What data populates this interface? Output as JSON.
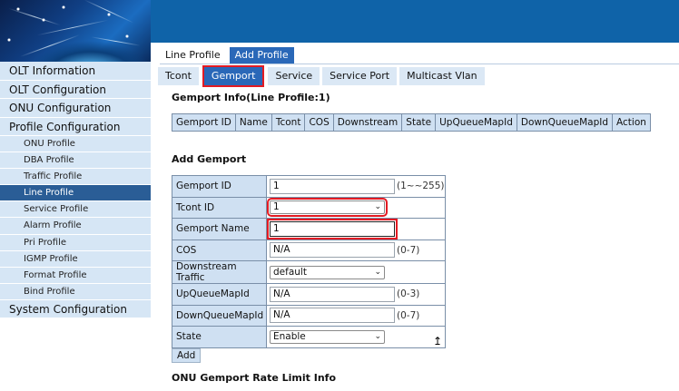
{
  "sidebar": {
    "items": [
      {
        "label": "OLT Information"
      },
      {
        "label": "OLT Configuration"
      },
      {
        "label": "ONU Configuration"
      },
      {
        "label": "Profile Configuration"
      }
    ],
    "profile_sub_items": [
      {
        "label": "ONU Profile"
      },
      {
        "label": "DBA Profile"
      },
      {
        "label": "Traffic Profile"
      },
      {
        "label": "Line Profile",
        "active": true
      },
      {
        "label": "Service Profile"
      },
      {
        "label": "Alarm Profile"
      },
      {
        "label": "Pri Profile"
      },
      {
        "label": "IGMP Profile"
      },
      {
        "label": "Format Profile"
      },
      {
        "label": "Bind Profile"
      }
    ],
    "last_item": {
      "label": "System Configuration"
    }
  },
  "top_tabs": [
    {
      "label": "Line Profile"
    },
    {
      "label": "Add Profile",
      "active": true
    }
  ],
  "sub_tabs": [
    {
      "label": "Tcont"
    },
    {
      "label": "Gemport",
      "active": true
    },
    {
      "label": "Service"
    },
    {
      "label": "Service Port"
    },
    {
      "label": "Multicast Vlan"
    }
  ],
  "gemport_info": {
    "title": "Gemport Info(Line Profile:1)",
    "columns": [
      "Gemport ID",
      "Name",
      "Tcont",
      "COS",
      "Downstream",
      "State",
      "UpQueueMapId",
      "DownQueueMapId",
      "Action"
    ]
  },
  "add_gemport": {
    "title": "Add Gemport",
    "fields": {
      "gemport_id": {
        "label": "Gemport ID",
        "value": "1",
        "hint": "(1~~255)"
      },
      "tcont_id": {
        "label": "Tcont ID",
        "value": "1"
      },
      "gemport_name": {
        "label": "Gemport Name",
        "value": "1"
      },
      "cos": {
        "label": "COS",
        "value": "N/A",
        "hint": "(0-7)"
      },
      "downstream_traffic": {
        "label": "Downstream Traffic",
        "value": "default"
      },
      "up_queue_map_id": {
        "label": "UpQueueMapId",
        "value": "N/A",
        "hint": "(0-3)"
      },
      "down_queue_map_id": {
        "label": "DownQueueMapId",
        "value": "N/A",
        "hint": "(0-7)"
      },
      "state": {
        "label": "State",
        "value": "Enable"
      }
    },
    "add_button_label": "Add"
  },
  "rate_limit": {
    "title": "ONU Gemport Rate Limit Info"
  },
  "icons": {
    "dropdown": "chevron-down-icon",
    "cursor": "mouse-pointer-icon"
  },
  "colors": {
    "banner": "#0f63a8",
    "active_tab": "#2a68b8",
    "highlight": "#e31b23",
    "active_nav": "#2a5d96",
    "sidebar": "#d6e6f5"
  }
}
